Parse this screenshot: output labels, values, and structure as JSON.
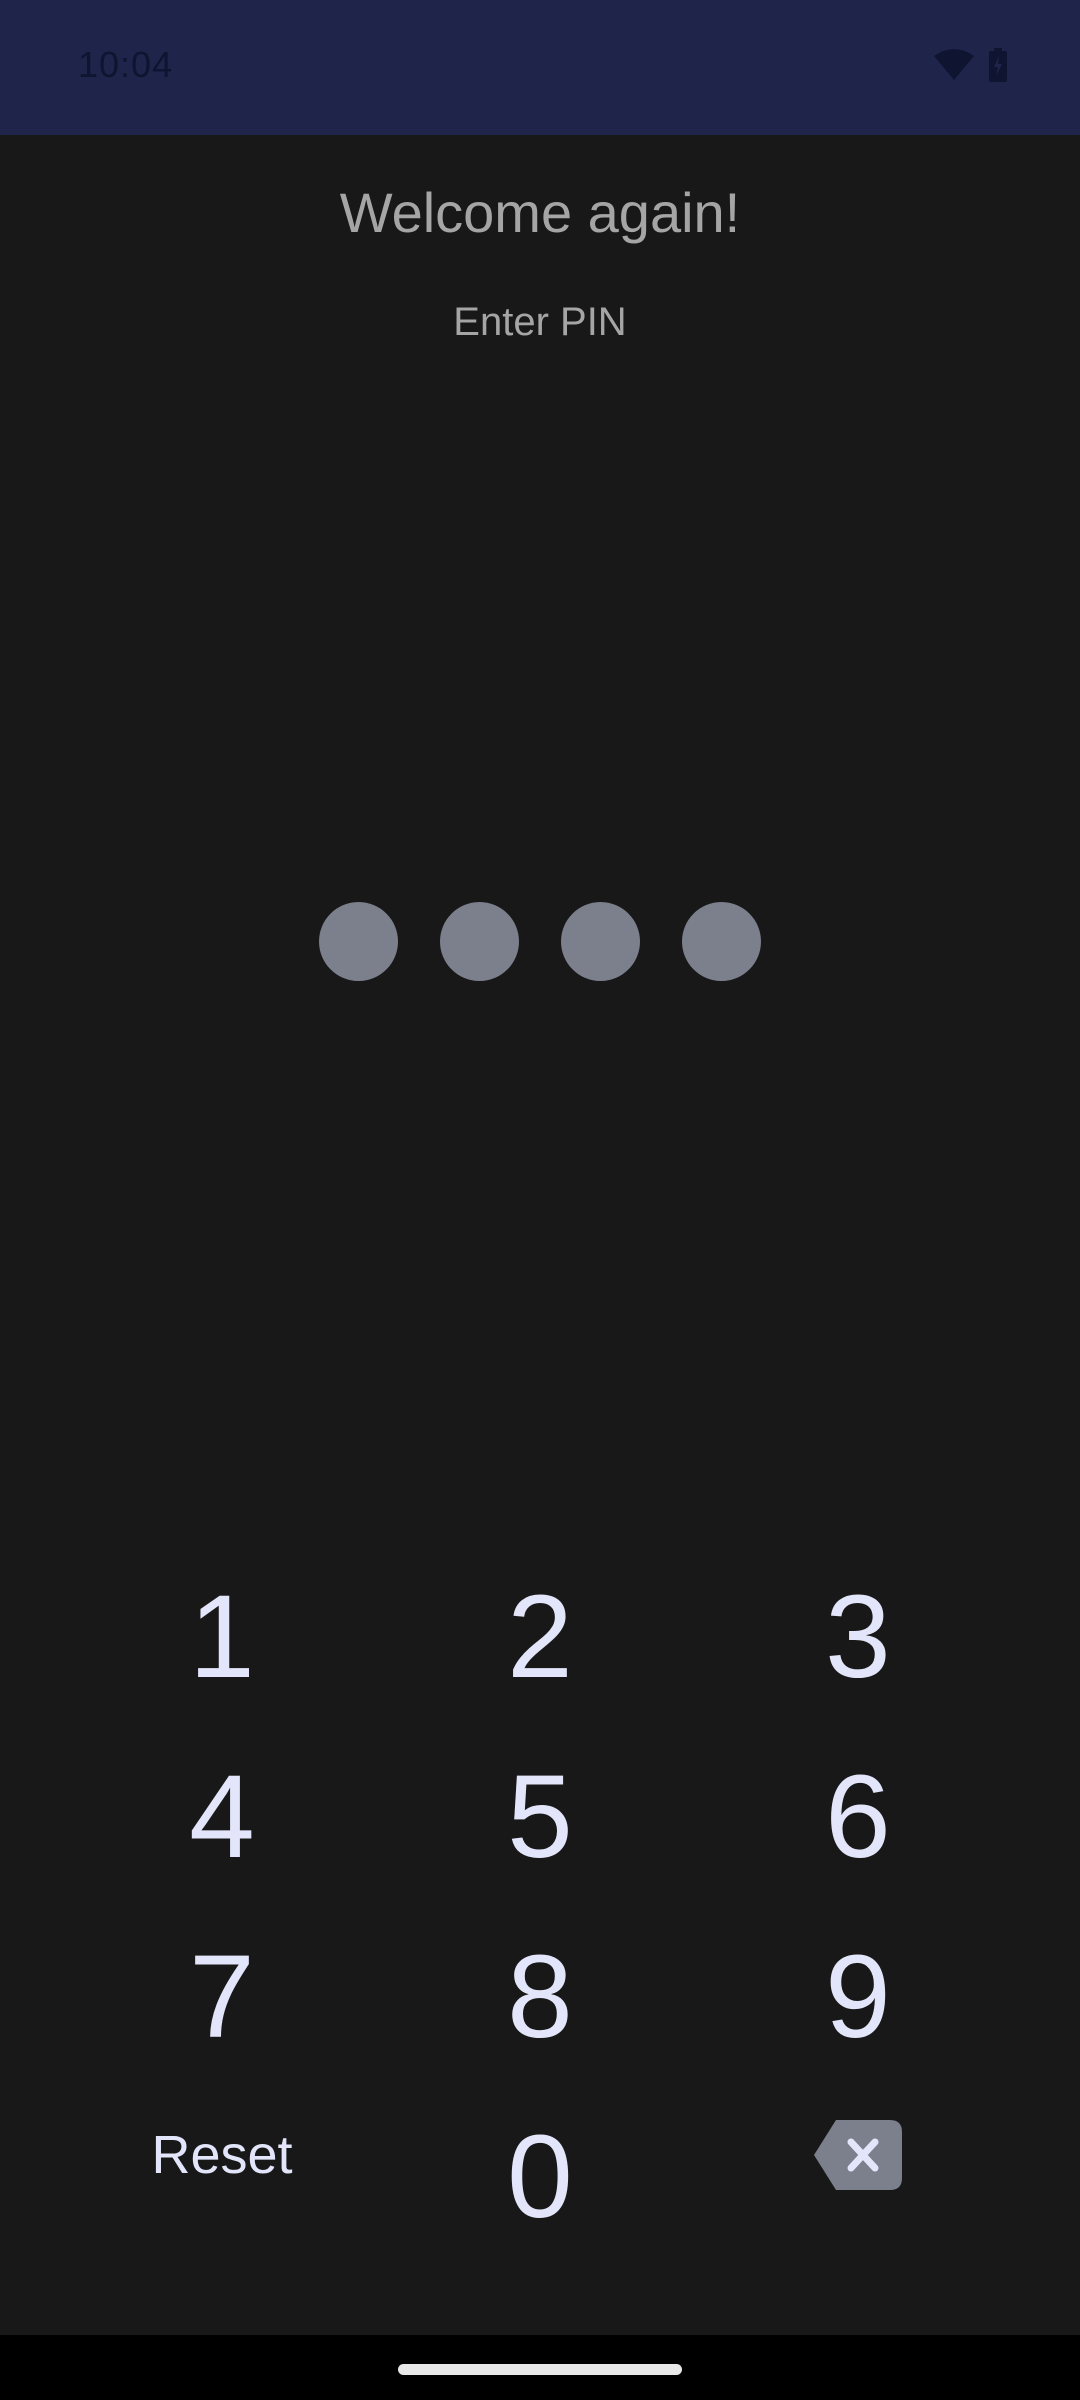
{
  "status_bar": {
    "time": "10:04",
    "icons": [
      "wifi-icon",
      "battery-charging-icon"
    ],
    "color": "#1f244b"
  },
  "screen": {
    "title": "Welcome again!",
    "subtitle": "Enter PIN"
  },
  "pin": {
    "length": 4,
    "dot_color": "#7c808d"
  },
  "keypad": {
    "keys": [
      "1",
      "2",
      "3",
      "4",
      "5",
      "6",
      "7",
      "8",
      "9"
    ],
    "zero": "0",
    "reset_label": "Reset",
    "backspace_icon": "backspace-icon",
    "key_color": "#e3e6fa"
  },
  "colors": {
    "background": "#181818",
    "text_secondary": "#a5a5a5"
  }
}
